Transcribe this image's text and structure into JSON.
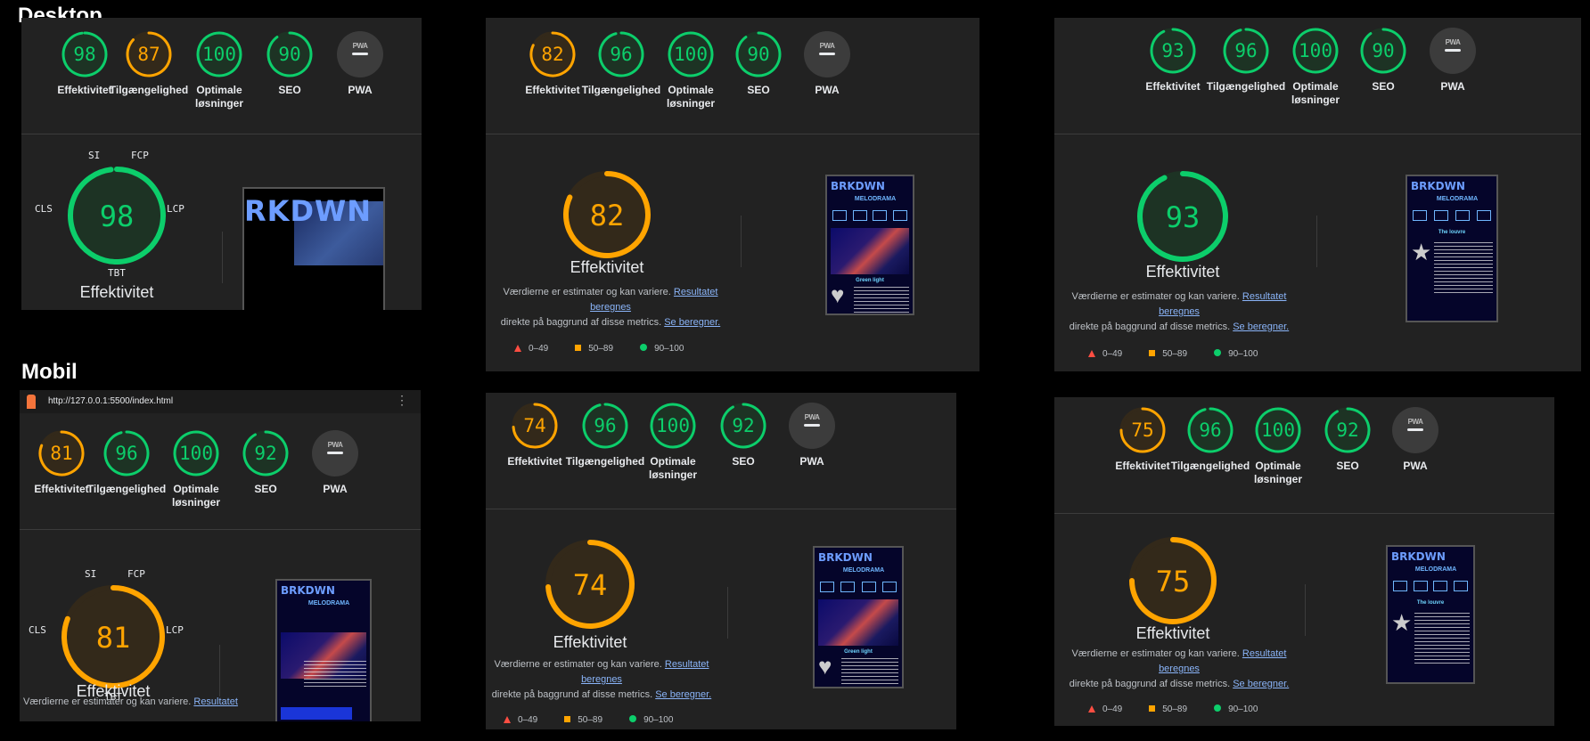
{
  "labels": {
    "desktop": "Desktop",
    "mobile": "Mobil"
  },
  "gauge_labels": {
    "performance": "Effektivitet",
    "accessibility": "Tilgængelighed",
    "best_practices": "Optimale løsninger",
    "seo": "SEO",
    "pwa": "PWA"
  },
  "pwa_badge": "PWA",
  "panels": [
    {
      "scores": {
        "performance": "98",
        "accessibility": "87",
        "best_practices": "100",
        "seo": "90"
      }
    },
    {
      "scores": {
        "performance": "82",
        "accessibility": "96",
        "best_practices": "100",
        "seo": "90"
      }
    },
    {
      "scores": {
        "performance": "93",
        "accessibility": "96",
        "best_practices": "100",
        "seo": "90"
      }
    },
    {
      "scores": {
        "performance": "81",
        "accessibility": "96",
        "best_practices": "100",
        "seo": "92"
      }
    },
    {
      "scores": {
        "performance": "74",
        "accessibility": "96",
        "best_practices": "100",
        "seo": "92"
      }
    },
    {
      "scores": {
        "performance": "75",
        "accessibility": "96",
        "best_practices": "100",
        "seo": "92"
      }
    }
  ],
  "big_scores": [
    "98",
    "82",
    "93",
    "81",
    "74",
    "75"
  ],
  "metric_labels": {
    "si": "SI",
    "fcp": "FCP",
    "lcp": "LCP",
    "cls": "CLS",
    "tbt": "TBT"
  },
  "big_title": "Effektivitet",
  "disclaimer": {
    "line1": "Værdierne er estimater og kan variere.",
    "link1": "Resultatet beregnes",
    "line2": "direkte på baggrund af disse metrics.",
    "link2": "Se beregner.",
    "link1_short": "Resultatet"
  },
  "legend": {
    "low": "0–49",
    "mid": "50–89",
    "high": "90–100"
  },
  "url": "http://127.0.0.1:5500/index.html",
  "thumb": {
    "title": "BRKDWN",
    "subtitle": "MELODRAMA",
    "caption_green": "Green light",
    "caption_louvre": "The louvre",
    "big_title": "RKDWN"
  },
  "colors": {
    "green": "#0cce6b",
    "orange": "#ffa400",
    "red": "#ff4e42",
    "bg": "#222222"
  }
}
